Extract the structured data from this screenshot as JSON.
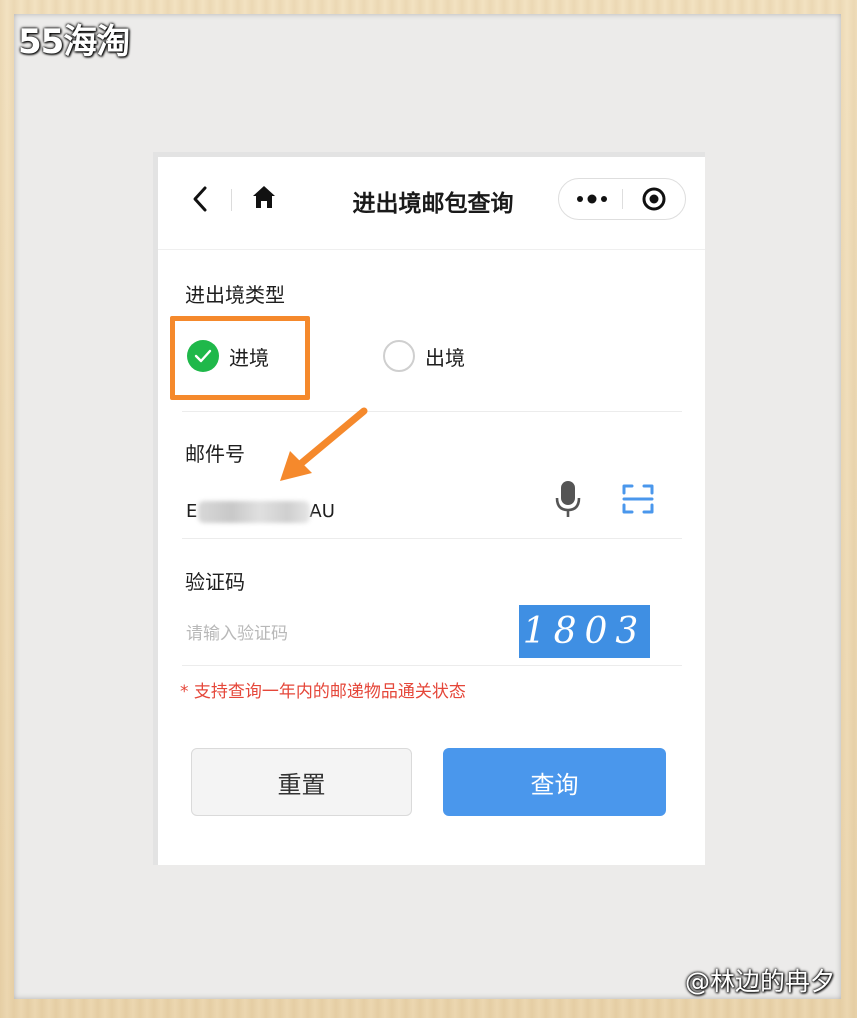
{
  "watermarks": {
    "top_left": "55海淘",
    "bottom_right": "@林边的冉夕"
  },
  "nav": {
    "title": "进出境邮包查询"
  },
  "form": {
    "type_label": "进出境类型",
    "options": [
      {
        "label": "进境",
        "selected": true
      },
      {
        "label": "出境",
        "selected": false
      }
    ],
    "mail_label": "邮件号",
    "mail_prefix": "E",
    "mail_suffix": "AU",
    "captcha_label": "验证码",
    "captcha_placeholder": "请输入验证码",
    "captcha_code": "1803",
    "note": "* 支持查询一年内的邮递物品通关状态"
  },
  "buttons": {
    "reset": "重置",
    "query": "查询"
  },
  "colors": {
    "accent": "#4a97ec",
    "selected_green": "#1fb84a",
    "warning_red": "#e5473a",
    "highlight_orange": "#f5892c"
  },
  "icons": {
    "back": "chevron-left-icon",
    "home": "home-icon",
    "more": "more-dots-icon",
    "close": "target-close-icon",
    "mic": "microphone-icon",
    "scan": "scan-icon"
  }
}
